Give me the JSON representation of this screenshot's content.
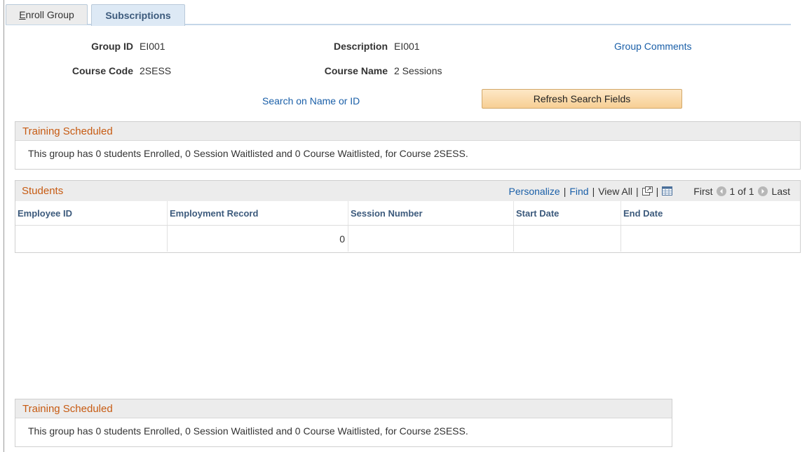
{
  "tabs": [
    {
      "accel": "E",
      "rest": "nroll Group",
      "active": false
    },
    {
      "label": "Subscriptions",
      "active": true
    }
  ],
  "header": {
    "group_id_label": "Group ID",
    "group_id_value": "EI001",
    "description_label": "Description",
    "description_value": "EI001",
    "group_comments_link": "Group Comments",
    "course_code_label": "Course Code",
    "course_code_value": "2SESS",
    "course_name_label": "Course Name",
    "course_name_value": "2 Sessions",
    "search_link": "Search on Name or ID",
    "refresh_button": "Refresh Search Fields"
  },
  "training_top": {
    "title": "Training Scheduled",
    "message": "This group has 0 students Enrolled, 0 Session Waitlisted and 0 Course Waitlisted, for Course 2SESS."
  },
  "students_grid": {
    "title": "Students",
    "nav": {
      "personalize": "Personalize",
      "find": "Find",
      "view_all": "View All",
      "first": "First",
      "range": "1 of 1",
      "last": "Last"
    },
    "columns": [
      "Employee ID",
      "Employment Record",
      "Session Number",
      "Start Date",
      "End Date"
    ],
    "rows": [
      {
        "employee_id": "",
        "employment_record": "0",
        "session_number": "",
        "start_date": "",
        "end_date": ""
      }
    ]
  },
  "training_bottom": {
    "title": "Training Scheduled",
    "message": "This group has 0 students Enrolled, 0 Session Waitlisted and 0 Course Waitlisted, for Course 2SESS."
  },
  "icons": {
    "new_window": "new-window-icon",
    "spreadsheet": "download-spreadsheet-icon",
    "prev": "previous-row-icon",
    "next": "next-row-icon"
  }
}
